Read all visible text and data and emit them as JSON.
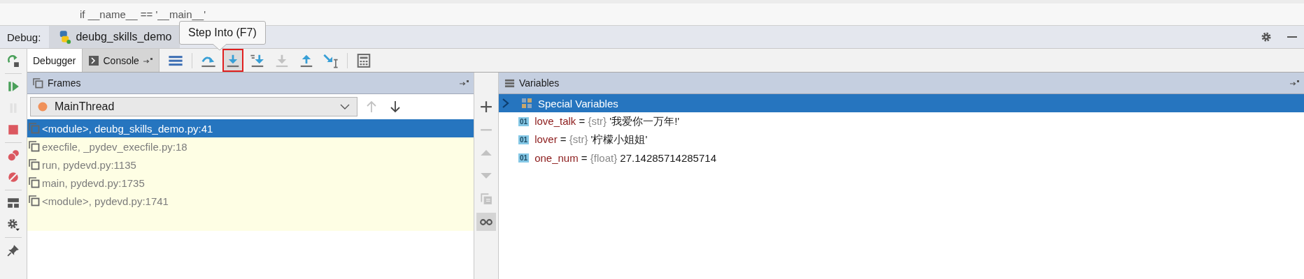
{
  "editor": {
    "code_line": "if __name__ == '__main__'"
  },
  "debug_bar": {
    "label": "Debug:",
    "session_tab": "deubg_skills_demo"
  },
  "tooltip": {
    "text": "Step Into (F7)"
  },
  "side_toolbar": [
    {
      "kind": "rerun",
      "disabled": false
    },
    {
      "kind": "resume",
      "disabled": false
    },
    {
      "kind": "pause",
      "disabled": true
    },
    {
      "kind": "stop",
      "disabled": false
    },
    {
      "kind": "breakpoints",
      "disabled": false
    },
    {
      "kind": "mute",
      "disabled": false
    },
    {
      "kind": "layout",
      "disabled": false
    },
    {
      "kind": "settings",
      "disabled": false
    },
    {
      "kind": "pin",
      "disabled": false
    }
  ],
  "tabs": [
    {
      "label": "Debugger",
      "selected": true
    },
    {
      "label": "Console",
      "selected": false
    }
  ],
  "toolbar": [
    {
      "kind": "show-execution-point",
      "disabled": false,
      "highlighted": false
    },
    {
      "kind": "step-over",
      "disabled": false,
      "highlighted": false
    },
    {
      "kind": "step-into",
      "disabled": false,
      "highlighted": true
    },
    {
      "kind": "step-into-my-code",
      "disabled": false,
      "highlighted": false
    },
    {
      "kind": "force-step-into",
      "disabled": true,
      "highlighted": false
    },
    {
      "kind": "step-out",
      "disabled": false,
      "highlighted": false
    },
    {
      "kind": "run-to-cursor",
      "disabled": false,
      "highlighted": false
    },
    {
      "kind": "evaluate",
      "disabled": false,
      "highlighted": false
    }
  ],
  "frames": {
    "title": "Frames",
    "thread": "MainThread",
    "nav": [
      {
        "kind": "up",
        "disabled": true
      },
      {
        "kind": "down",
        "disabled": false
      }
    ],
    "items": [
      {
        "label": "<module>, deubg_skills_demo.py:41",
        "selected": true
      },
      {
        "label": "execfile, _pydev_execfile.py:18",
        "selected": false
      },
      {
        "label": "run, pydevd.py:1135",
        "selected": false
      },
      {
        "label": "main, pydevd.py:1735",
        "selected": false
      },
      {
        "label": "<module>, pydevd.py:1741",
        "selected": false
      }
    ]
  },
  "watch_toolbar": [
    {
      "kind": "add",
      "disabled": false,
      "selected": false
    },
    {
      "kind": "remove",
      "disabled": true,
      "selected": false
    },
    {
      "kind": "up",
      "disabled": true,
      "selected": false
    },
    {
      "kind": "down",
      "disabled": true,
      "selected": false
    },
    {
      "kind": "copy",
      "disabled": true,
      "selected": false
    },
    {
      "kind": "watches",
      "disabled": false,
      "selected": true
    }
  ],
  "variables": {
    "title": "Variables",
    "items": [
      {
        "kind": "group",
        "name": "Special Variables",
        "selected": true,
        "expanded": false
      },
      {
        "kind": "value",
        "badge": "01",
        "name": "love_talk",
        "operator": "=",
        "type": "{str}",
        "value": "'我爱你一万年!'",
        "selected": false
      },
      {
        "kind": "value",
        "badge": "01",
        "name": "lover",
        "operator": "=",
        "type": "{str}",
        "value": "'柠檬小姐姐'",
        "selected": false
      },
      {
        "kind": "value",
        "badge": "01",
        "name": "one_num",
        "operator": "=",
        "type": "{float}",
        "value": "27.14285714285714",
        "selected": false
      }
    ]
  }
}
